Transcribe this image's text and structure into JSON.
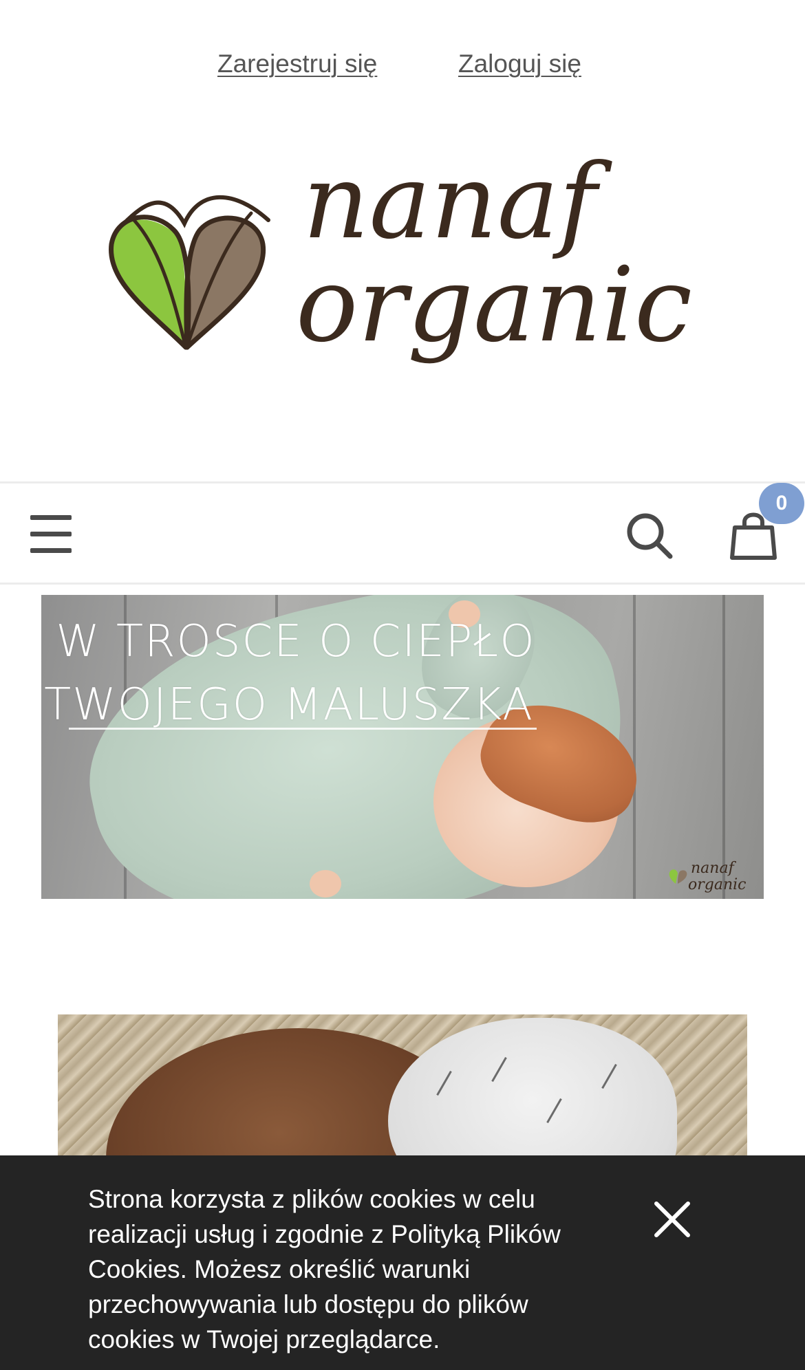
{
  "header": {
    "register_label": "Zarejestruj się",
    "login_label": "Zaloguj się"
  },
  "brand": {
    "logo_text_line1": "nanaf",
    "logo_text_line2": "organic",
    "colors": {
      "leaf_green": "#8cc63f",
      "leaf_brown": "#8b7764",
      "ink": "#3b2a1e"
    }
  },
  "nav": {
    "menu_icon": "hamburger-menu-icon",
    "search_icon": "search-icon",
    "cart_icon": "shopping-bag-icon",
    "cart_count": "0",
    "badge_color": "#7f9fd2"
  },
  "hero": {
    "line1": "W TROSCE O CIEPŁO",
    "line2": "TWOJEGO MALUSZKA"
  },
  "cookie_banner": {
    "text": "Strona korzysta z plików cookies w celu realizacji usług i zgodnie z Polityką Plików Cookies. Możesz określić warunki przechowywania lub dostępu do plików cookies w Twojej przeglądarce.",
    "close_icon": "close-icon"
  }
}
